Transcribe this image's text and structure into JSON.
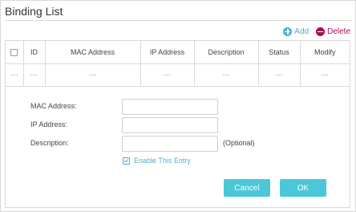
{
  "panel": {
    "title": "Binding List"
  },
  "toolbar": {
    "add_label": "Add",
    "delete_label": "Delete",
    "add_icon": "plus-circle-icon",
    "delete_icon": "minus-circle-icon",
    "add_color": "#4bb0d0",
    "delete_color": "#a90f58"
  },
  "table": {
    "columns": [
      "ID",
      "MAC Address",
      "IP Address",
      "Description",
      "Status",
      "Modify"
    ],
    "rows": [
      [
        "---",
        "---",
        "---",
        "---",
        "---",
        "---",
        "---"
      ]
    ]
  },
  "form": {
    "mac_label": "MAC Address:",
    "mac_value": "",
    "ip_label": "IP Address:",
    "ip_value": "",
    "description_label": "Description:",
    "description_value": "",
    "optional_hint": "(Optional)",
    "enable_label": "Enable This Entry",
    "enable_checked": true
  },
  "buttons": {
    "cancel": "Cancel",
    "ok": "OK",
    "color": "#4bc7d8"
  }
}
